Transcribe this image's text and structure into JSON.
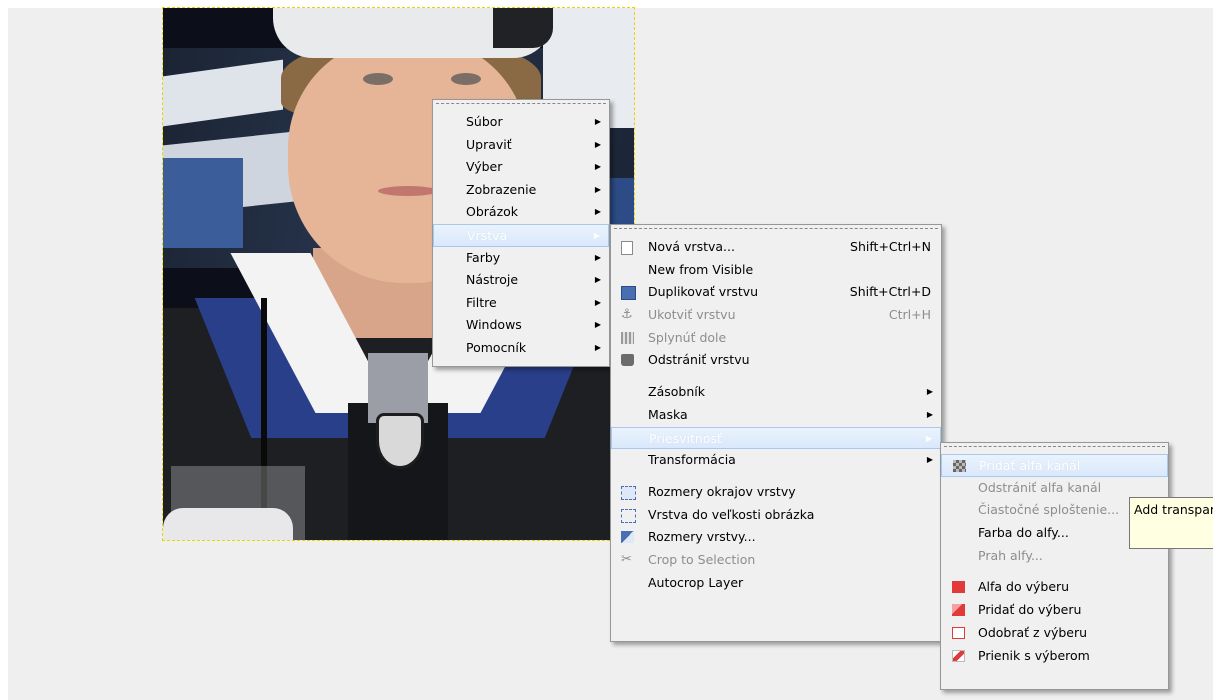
{
  "main_menu": {
    "items": [
      {
        "label": "Súbor",
        "has_submenu": true,
        "disabled": false,
        "highlighted": false
      },
      {
        "label": "Upraviť",
        "has_submenu": true,
        "disabled": false,
        "highlighted": false
      },
      {
        "label": "Výber",
        "has_submenu": true,
        "disabled": false,
        "highlighted": false
      },
      {
        "label": "Zobrazenie",
        "has_submenu": true,
        "disabled": false,
        "highlighted": false
      },
      {
        "label": "Obrázok",
        "has_submenu": true,
        "disabled": false,
        "highlighted": false
      },
      {
        "label": "Vrstva",
        "has_submenu": true,
        "disabled": false,
        "highlighted": true
      },
      {
        "label": "Farby",
        "has_submenu": true,
        "disabled": false,
        "highlighted": false
      },
      {
        "label": "Nástroje",
        "has_submenu": true,
        "disabled": false,
        "highlighted": false
      },
      {
        "label": "Filtre",
        "has_submenu": true,
        "disabled": false,
        "highlighted": false
      },
      {
        "label": "Windows",
        "has_submenu": true,
        "disabled": false,
        "highlighted": false
      },
      {
        "label": "Pomocník",
        "has_submenu": true,
        "disabled": false,
        "highlighted": false
      }
    ]
  },
  "layer_menu": {
    "items": [
      {
        "label": "Nová vrstva...",
        "shortcut": "Shift+Ctrl+N",
        "icon": "new-layer-icon"
      },
      {
        "label": "New from Visible",
        "shortcut": "",
        "icon": ""
      },
      {
        "label": "Duplikovať vrstvu",
        "shortcut": "Shift+Ctrl+D",
        "icon": "duplicate-layer-icon"
      },
      {
        "label": "Ukotviť vrstvu",
        "shortcut": "Ctrl+H",
        "icon": "anchor-icon",
        "disabled": true
      },
      {
        "label": "Splynúť dole",
        "shortcut": "",
        "icon": "merge-down-icon",
        "disabled": true
      },
      {
        "label": "Odstrániť vrstvu",
        "shortcut": "",
        "icon": "trash-icon"
      },
      {
        "label": "Zásobník",
        "submenu": true
      },
      {
        "label": "Maska",
        "submenu": true
      },
      {
        "label": "Priesvitnosť",
        "submenu": true,
        "highlighted": true
      },
      {
        "label": "Transformácia",
        "submenu": true
      },
      {
        "label": "Rozmery okrajov vrstvy",
        "icon": "layer-boundary-icon"
      },
      {
        "label": "Vrstva do veľkosti obrázka",
        "icon": "layer-to-image-size-icon"
      },
      {
        "label": "Rozmery vrstvy...",
        "icon": "scale-layer-icon"
      },
      {
        "label": "Crop to Selection",
        "icon": "crop-icon",
        "disabled": true
      },
      {
        "label": "Autocrop Layer",
        "icon": ""
      }
    ]
  },
  "transparency_menu": {
    "items": [
      {
        "label": "Pridať alfa kanál",
        "highlighted": true,
        "icon": "alpha-channel-icon"
      },
      {
        "label": "Odstrániť alfa kanál",
        "disabled": true
      },
      {
        "label": "Čiastočné sploštenie...",
        "disabled": true
      },
      {
        "label": "Farba do alfy...",
        "disabled": false
      },
      {
        "label": "Prah alfy...",
        "disabled": true
      },
      {
        "label": "Alfa do výberu",
        "icon": "alpha-to-selection-icon"
      },
      {
        "label": "Pridať do výberu",
        "icon": "add-to-selection-icon"
      },
      {
        "label": "Odobrať z výberu",
        "icon": "subtract-from-selection-icon"
      },
      {
        "label": "Prienik s výberom",
        "icon": "intersect-selection-icon"
      }
    ]
  },
  "tooltip": {
    "text": "Add transpar"
  }
}
